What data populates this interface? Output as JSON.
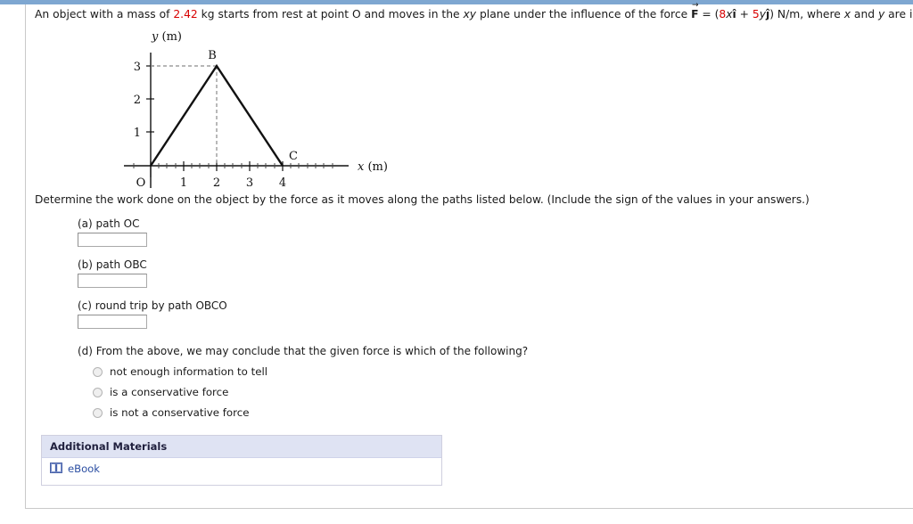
{
  "colors": {
    "topbar": "#7ea7d1",
    "accent_red": "#d80000",
    "panel_header": "#dfe3f3",
    "link": "#2b4ea2"
  },
  "stem": {
    "part1": "An object with a mass of ",
    "mass": "2.42",
    "part2": " kg starts from rest at point O and moves in the ",
    "plane": "xy",
    "part3": " plane under the influence of the force ",
    "force_symbol": "F",
    "force_eq_open": " = (",
    "coef_x": "8",
    "var_x": "x",
    "unit_i": "î",
    "plus": " + ",
    "coef_y": "5",
    "var_y": "y",
    "unit_j": "ĵ",
    "force_eq_close": ") N/m, where ",
    "var_x2": "x",
    "and": " and ",
    "var_y2": "y",
    "part4": " are in meters."
  },
  "chart_data": {
    "type": "line",
    "title": "",
    "xlabel": "x  (m)",
    "ylabel": "y  (m)",
    "xlim": [
      0,
      4.6
    ],
    "ylim": [
      0,
      3.6
    ],
    "xticks": [
      1,
      2,
      3,
      4
    ],
    "yticks": [
      1,
      2,
      3
    ],
    "xtick_labels": [
      "1",
      "2",
      "3",
      "4"
    ],
    "ytick_labels": [
      "1",
      "2",
      "3"
    ],
    "origin_label": "O",
    "grid": false,
    "minor_ticks": true,
    "series": [
      {
        "name": "path OBC",
        "points": [
          [
            0,
            0
          ],
          [
            2,
            3
          ],
          [
            4,
            0
          ]
        ],
        "style": "solid",
        "color": "#000000"
      }
    ],
    "guides": [
      {
        "name": "horizontal-guide-to-B",
        "from": [
          0,
          3
        ],
        "to": [
          2,
          3
        ],
        "style": "dashed"
      },
      {
        "name": "vertical-guide-to-B",
        "from": [
          2,
          3
        ],
        "to": [
          2,
          0
        ],
        "style": "dashed"
      }
    ],
    "annotations": [
      {
        "label": "B",
        "x": 2,
        "y": 3,
        "position": "above"
      },
      {
        "label": "C",
        "x": 4,
        "y": 0,
        "position": "above-right"
      }
    ]
  },
  "determine_text": "Determine the work done on the object by the force as it moves along the paths listed below. (Include the sign of the values in your answers.)",
  "questions": [
    {
      "label": "(a) path OC",
      "value": "",
      "placeholder": ""
    },
    {
      "label": "(b) path OBC",
      "value": "",
      "placeholder": ""
    },
    {
      "label": "(c) round trip by path OBCO",
      "value": "",
      "placeholder": ""
    }
  ],
  "part_d": {
    "label": "(d) From the above, we may conclude that the given force is which of the following?",
    "options": [
      {
        "label": "not enough information to tell",
        "selected": false
      },
      {
        "label": "is a conservative force",
        "selected": false
      },
      {
        "label": "is not a conservative force",
        "selected": false
      }
    ]
  },
  "materials": {
    "header": "Additional Materials",
    "items": [
      {
        "icon": "book-icon",
        "label": "eBook"
      }
    ]
  }
}
